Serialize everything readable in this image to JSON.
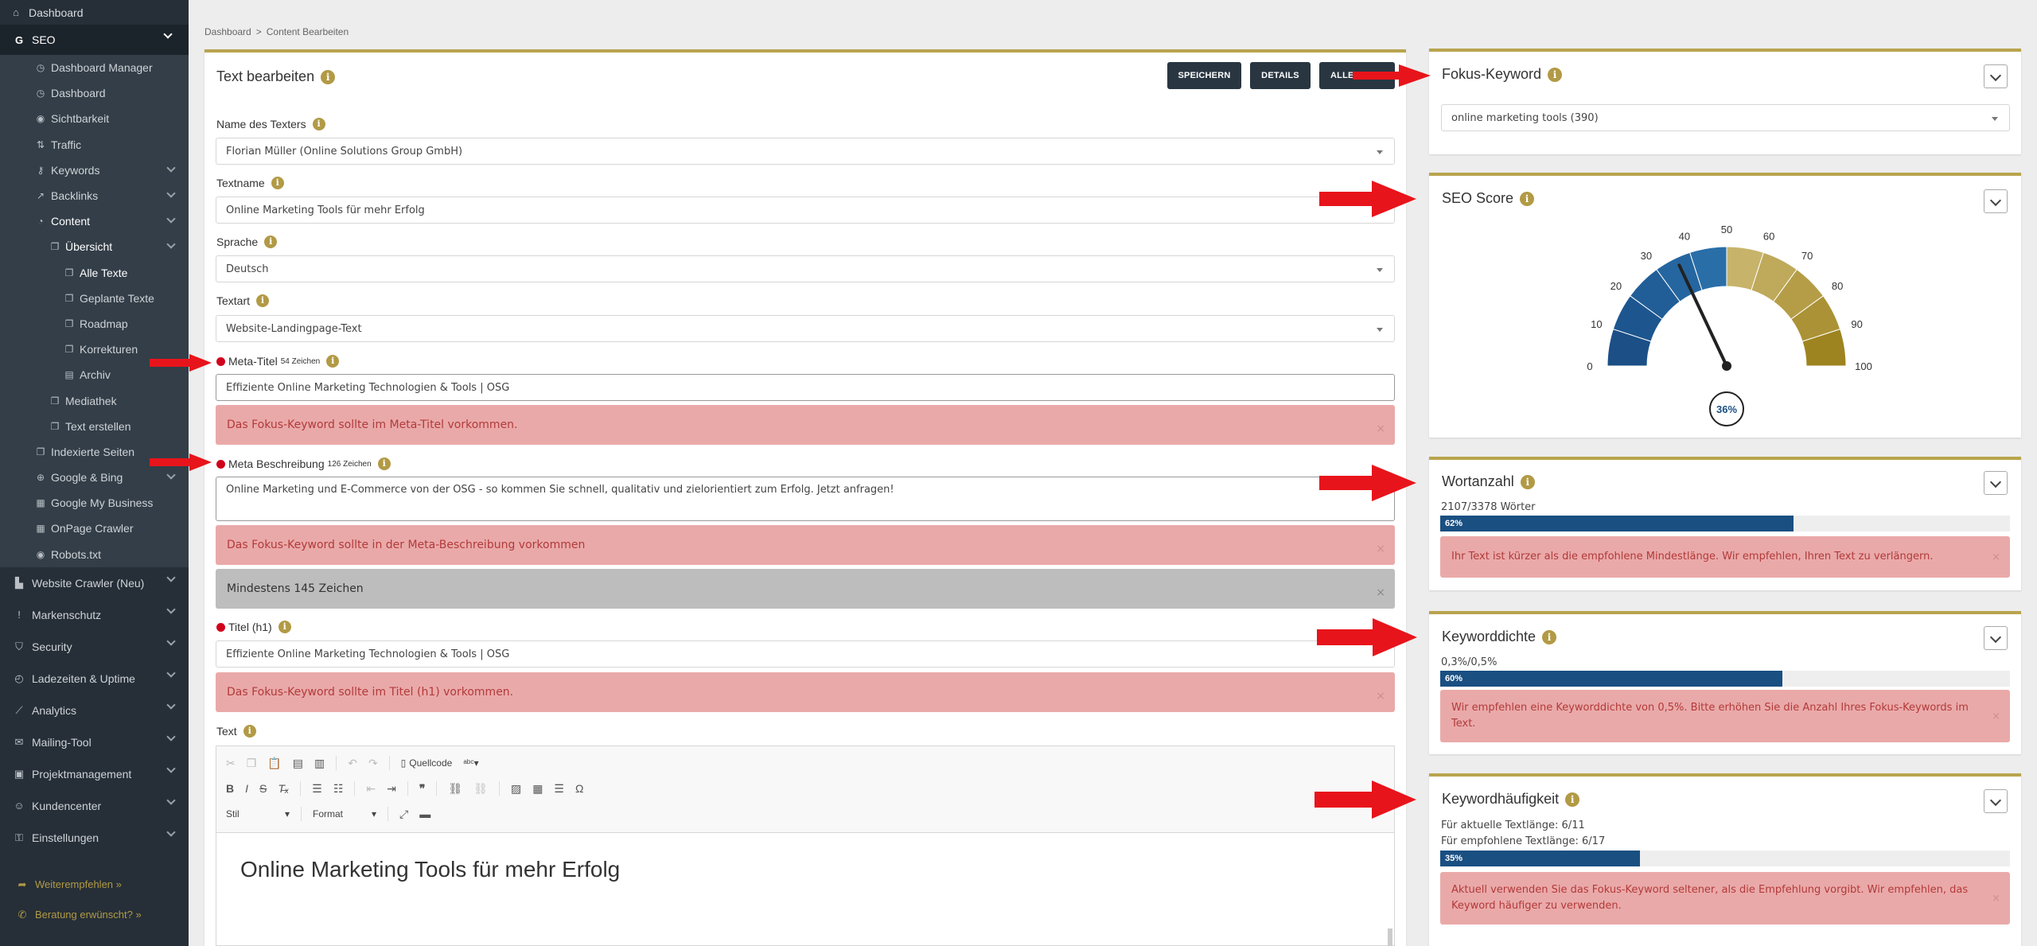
{
  "sidebar": {
    "dashboard": "Dashboard",
    "seo": "SEO",
    "dashboard_manager": "Dashboard Manager",
    "seo_dashboard": "Dashboard",
    "sichtbarkeit": "Sichtbarkeit",
    "traffic": "Traffic",
    "keywords": "Keywords",
    "backlinks": "Backlinks",
    "content": "Content",
    "uebersicht": "Übersicht",
    "alle_texte": "Alle Texte",
    "geplante_texte": "Geplante Texte",
    "roadmap": "Roadmap",
    "korrekturen": "Korrekturen",
    "archiv": "Archiv",
    "mediathek": "Mediathek",
    "text_erstellen": "Text erstellen",
    "indexierte_seiten": "Indexierte Seiten",
    "google_bing": "Google & Bing",
    "google_my_business": "Google My Business",
    "onpage_crawler": "OnPage Crawler",
    "robots": "Robots.txt",
    "website_crawler": "Website Crawler (Neu)",
    "markenschutz": "Markenschutz",
    "security": "Security",
    "ladezeiten": "Ladezeiten & Uptime",
    "analytics": "Analytics",
    "mailing": "Mailing-Tool",
    "projektmanagement": "Projektmanagement",
    "kundencenter": "Kundencenter",
    "einstellungen": "Einstellungen",
    "weiterempfehlen": "Weiterempfehlen »",
    "beratung": "Beratung erwünscht? »"
  },
  "breadcrumb": {
    "home": "Dashboard",
    "sep": ">",
    "current": "Content Bearbeiten"
  },
  "editor": {
    "title": "Text bearbeiten",
    "btn_save": "SPEICHERN",
    "btn_details": "DETAILS",
    "btn_all": "ALLE T",
    "texter_label": "Name des Texters",
    "texter_value": "Florian Müller (Online Solutions Group GmbH)",
    "textname_label": "Textname",
    "textname_value": "Online Marketing Tools für mehr Erfolg",
    "sprache_label": "Sprache",
    "sprache_value": "Deutsch",
    "textart_label": "Textart",
    "textart_value": "Website-Landingpage-Text",
    "meta_title_label": "Meta-Titel",
    "meta_title_count": "54 Zeichen",
    "meta_title_value": "Effiziente Online Marketing Technologien & Tools | OSG",
    "meta_title_alert": "Das Fokus-Keyword sollte im Meta-Titel vorkommen.",
    "meta_desc_label": "Meta Beschreibung",
    "meta_desc_count": "126 Zeichen",
    "meta_desc_value": "Online Marketing und E-Commerce von der OSG - so kommen Sie schnell, qualitativ und zielorientiert zum Erfolg. Jetzt anfragen!",
    "meta_desc_alert": "Das Fokus-Keyword sollte in der Meta-Beschreibung vorkommen",
    "meta_desc_min": "Mindestens 145 Zeichen",
    "h1_label": "Titel (h1)",
    "h1_value": "Effiziente Online Marketing Technologien & Tools | OSG",
    "h1_alert": "Das Fokus-Keyword sollte im Titel (h1) vorkommen.",
    "text_label": "Text",
    "quellcode": "Quellcode",
    "stil": "Stil",
    "format": "Format",
    "content_heading": "Online Marketing Tools für mehr Erfolg",
    "close": "×"
  },
  "right": {
    "fokus_title": "Fokus-Keyword",
    "fokus_value": "online marketing tools (390)",
    "seo_title": "SEO Score",
    "seo_score": 36,
    "seo_score_label": "36%",
    "gauge_ticks": [
      "0",
      "10",
      "20",
      "30",
      "40",
      "50",
      "60",
      "70",
      "80",
      "90",
      "100"
    ],
    "wort_title": "Wortanzahl",
    "wort_count": "2107/3378 Wörter",
    "wort_pct": 62,
    "wort_pct_label": "62%",
    "wort_alert": "Ihr Text ist kürzer als die empfohlene Mindestlänge. Wir empfehlen, Ihren Text zu verlängern.",
    "kd_title": "Keyworddichte",
    "kd_value": "0,3%/0,5%",
    "kd_pct": 60,
    "kd_pct_label": "60%",
    "kd_alert": "Wir empfehlen eine Keyworddichte von 0,5%. Bitte erhöhen Sie die Anzahl Ihres Fokus-Keywords im Text.",
    "kh_title": "Keywordhäufigkeit",
    "kh_current": "Für aktuelle Textlänge: 6/11",
    "kh_recommended": "Für empfohlene Textlänge: 6/17",
    "kh_pct": 35,
    "kh_pct_label": "35%",
    "kh_alert": "Aktuell verwenden Sie das Fokus-Keyword seltener, als die Empfehlung vorgibt. Wir empfehlen, das Keyword häufiger zu verwenden."
  },
  "colors": {
    "accent": "#b8a44e",
    "bar": "#1a4f82",
    "alert_bg": "#eaa9a9",
    "arrow": "#e8141b"
  }
}
